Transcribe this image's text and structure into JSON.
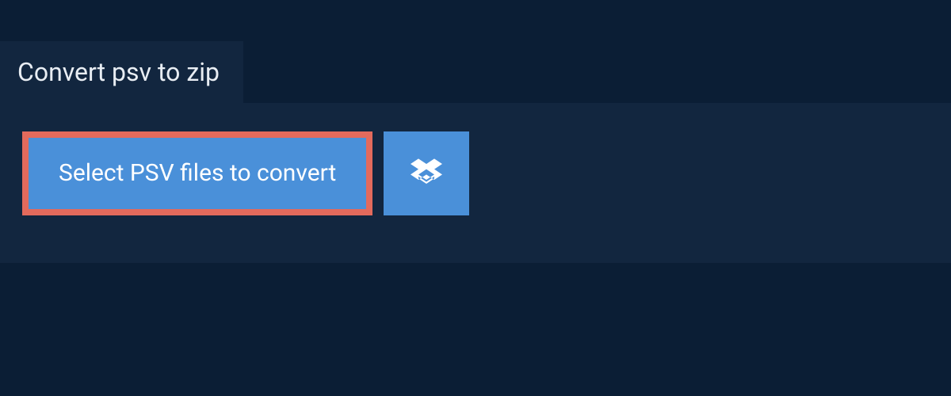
{
  "tab": {
    "title": "Convert psv to zip"
  },
  "actions": {
    "select_label": "Select PSV files to convert"
  },
  "colors": {
    "page_bg": "#0b1e35",
    "panel_bg": "#12263f",
    "button_bg": "#4a90d9",
    "highlight_border": "#e36a5c",
    "text_light": "#ffffff"
  }
}
